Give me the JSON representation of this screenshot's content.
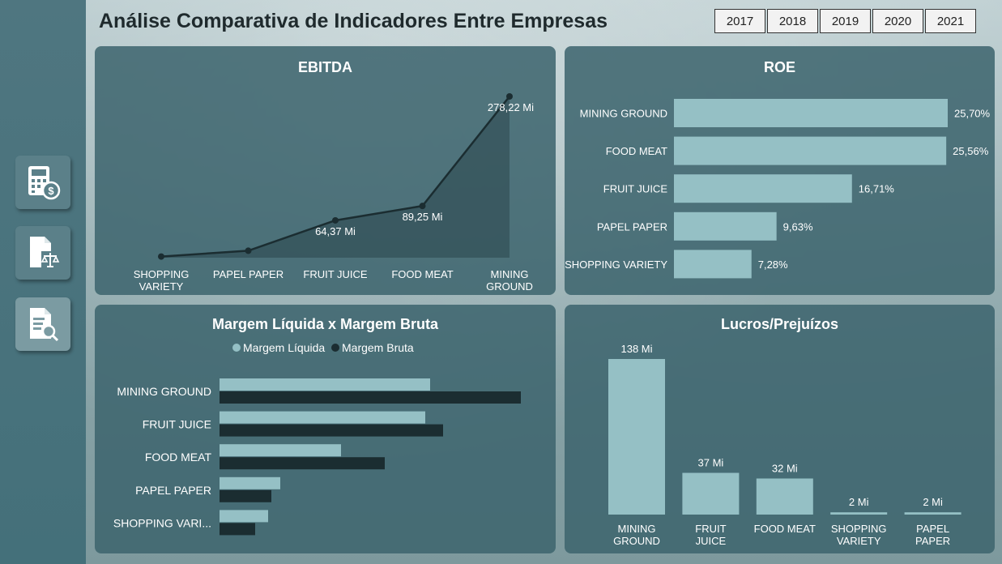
{
  "page": {
    "title": "Análise Comparativa de Indicadores Entre Empresas"
  },
  "years": [
    "2017",
    "2018",
    "2019",
    "2020",
    "2021"
  ],
  "nav": [
    {
      "icon": "calculator-dollar-icon"
    },
    {
      "icon": "document-balance-icon"
    },
    {
      "icon": "document-search-icon",
      "active": true
    }
  ],
  "colors": {
    "light_bar": "#95c0c5",
    "dark_bar": "#1b2d31",
    "line": "#1b2d31",
    "text": "#ffffff"
  },
  "chart_data": [
    {
      "id": "ebitda",
      "type": "area",
      "title": "EBITDA",
      "categories": [
        "SHOPPING VARIETY",
        "PAPEL PAPER",
        "FRUIT JUICE",
        "FOOD MEAT",
        "MINING GROUND"
      ],
      "values": [
        2,
        12,
        64.37,
        89.25,
        278.22
      ],
      "labels": [
        "",
        "",
        "64,37 Mi",
        "89,25 Mi",
        "278,22 Mi"
      ]
    },
    {
      "id": "roe",
      "type": "bar",
      "orientation": "horizontal",
      "title": "ROE",
      "categories": [
        "MINING GROUND",
        "FOOD MEAT",
        "FRUIT JUICE",
        "PAPEL PAPER",
        "SHOPPING VARIETY"
      ],
      "values": [
        25.7,
        25.56,
        16.71,
        9.63,
        7.28
      ],
      "labels": [
        "25,70%",
        "25,56%",
        "16,71%",
        "9,63%",
        "7,28%"
      ]
    },
    {
      "id": "margem",
      "type": "bar",
      "orientation": "horizontal",
      "title": "Margem Líquida x Margem Bruta",
      "legend_position": "top",
      "categories": [
        "MINING GROUND",
        "FRUIT JUICE",
        "FOOD MEAT",
        "PAPEL PAPER",
        "SHOPPING VARI..."
      ],
      "series": [
        {
          "name": "Margem Líquida",
          "values": [
            26,
            25.4,
            15,
            7.5,
            6
          ]
        },
        {
          "name": "Margem Bruta",
          "values": [
            37.2,
            27.6,
            20.4,
            6.4,
            4.4
          ]
        }
      ]
    },
    {
      "id": "lucros",
      "type": "bar",
      "title": "Lucros/Prejuízos",
      "categories": [
        "MINING GROUND",
        "FRUIT JUICE",
        "FOOD MEAT",
        "SHOPPING VARIETY",
        "PAPEL PAPER"
      ],
      "values": [
        138,
        37,
        32,
        2,
        2
      ],
      "labels": [
        "138 Mi",
        "37 Mi",
        "32 Mi",
        "2 Mi",
        "2 Mi"
      ]
    }
  ]
}
